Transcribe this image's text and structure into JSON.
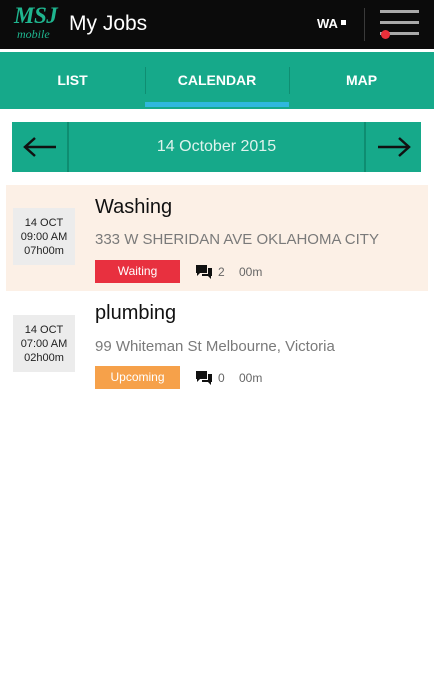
{
  "appbar": {
    "logo_big": "MSJ",
    "logo_small": "mobile",
    "title": "My Jobs",
    "region": "WA",
    "menu_icon": "hamburger-menu-icon",
    "notification_color": "#e8303a"
  },
  "tabs": [
    {
      "label": "LIST",
      "selected": false
    },
    {
      "label": "CALENDAR",
      "selected": true
    },
    {
      "label": "MAP",
      "selected": false
    }
  ],
  "datenav": {
    "prev_icon": "arrow-left-icon",
    "date": "14 October 2015",
    "next_icon": "arrow-right-icon"
  },
  "jobs": [
    {
      "date": "14 OCT",
      "time": "09:00 AM",
      "duration_hours": "07h00m",
      "title": "Washing",
      "address": "333 W SHERIDAN AVE OKLAHOMA CITY",
      "status": "Waiting",
      "status_color": "#e8303f",
      "messages": "2",
      "elapsed": "00m"
    },
    {
      "date": "14 OCT",
      "time": "07:00 AM",
      "duration_hours": "02h00m",
      "title": "plumbing",
      "address": "99 Whiteman St Melbourne, Victoria",
      "status": "Upcoming",
      "status_color": "#f6a14a",
      "messages": "0",
      "elapsed": "00m"
    }
  ],
  "colors": {
    "brand": "#16a98a",
    "tab_indicator": "#2fb8de",
    "appbar": "#0b0b0b",
    "active_row": "#fcf0e6"
  }
}
